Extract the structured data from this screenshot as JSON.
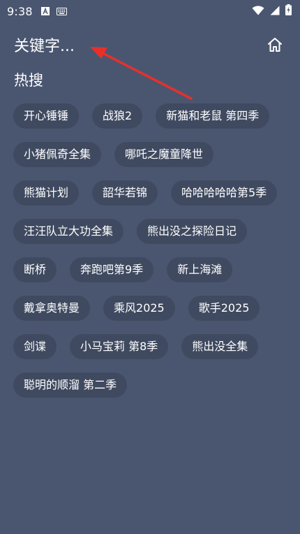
{
  "status_bar": {
    "time": "9:38",
    "left_icons": [
      "font-icon",
      "keyboard-icon"
    ],
    "right_icons": [
      "wifi-icon",
      "signal-icon",
      "battery-icon"
    ]
  },
  "header": {
    "search_placeholder": "关键字...",
    "home_icon": "home-icon"
  },
  "hot_search": {
    "title": "热搜",
    "rows": [
      [
        "开心锤锤",
        "战狼2",
        "新猫和老鼠 第四季"
      ],
      [
        "小猪佩奇全集",
        "哪吒之魔童降世"
      ],
      [
        "熊猫计划",
        "韶华若锦",
        "哈哈哈哈哈第5季"
      ],
      [
        "汪汪队立大功全集",
        "熊出没之探险日记"
      ],
      [
        "断桥",
        "奔跑吧第9季",
        "新上海滩"
      ],
      [
        "戴拿奥特曼",
        "乘风2025",
        "歌手2025"
      ],
      [
        "剑谍",
        "小马宝莉 第8季",
        "熊出没全集"
      ],
      [
        "聪明的顺溜 第二季"
      ]
    ]
  },
  "colors": {
    "background": "#4a5670",
    "tag_background": "#3f4a60",
    "annotation_arrow": "#e8302a"
  }
}
